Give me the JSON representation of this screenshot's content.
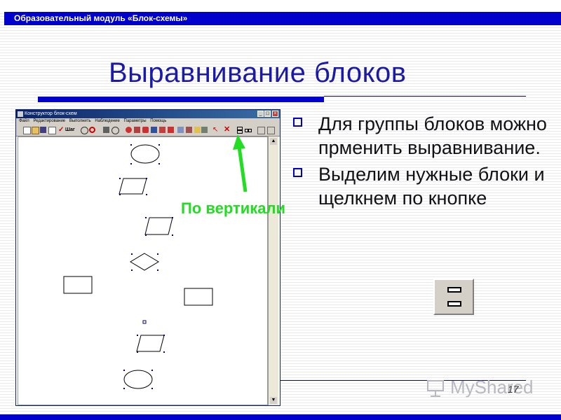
{
  "header": {
    "text": "Образовательный модуль «Блок-схемы»"
  },
  "slide": {
    "title": "Выравнивание блоков",
    "bullets": [
      "Для группы блоков можно прменить выравнивание.",
      "Выделим нужные блоки и щелкнем по кнопке"
    ],
    "annotation": "По вертикали",
    "page_number": "17"
  },
  "app": {
    "title": "Конструктор блок-схем",
    "menu": [
      "Файл",
      "Редактирование",
      "Выполнить",
      "Наблюдение",
      "Параметры",
      "Помощь"
    ],
    "toolbar_step_label": "Шаг",
    "window_buttons": [
      "_",
      "□",
      "×"
    ]
  },
  "watermark": {
    "text": "MyShared"
  },
  "colors": {
    "header_bg": "#0000cc",
    "title_text": "#1a1aa8",
    "annotation": "#22dd22",
    "arrow": "#22dd22",
    "bullet_marker": "#0000cc"
  },
  "icons": [
    "bullet-square-icon",
    "align-vertical-icon",
    "green-arrow-icon"
  ]
}
